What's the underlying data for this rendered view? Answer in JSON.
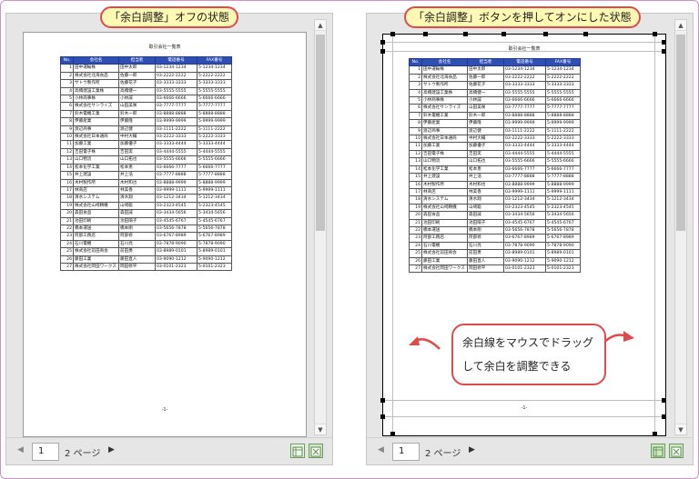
{
  "left_label": "「余白調整」オフの状態",
  "right_label": "「余白調整」ボタンを押してオンにした状態",
  "callout_line1": "余白線をマウスでドラッグ",
  "callout_line2": "して余白を調整できる",
  "sheet_title": "取引会社一覧表",
  "page_number_mark": "-1-",
  "page_input_value": "1",
  "page_total": "2 ページ",
  "columns": [
    "No.",
    "会社名",
    "担当者",
    "電話番号",
    "FAX番号"
  ],
  "rows": [
    [
      "1",
      "田中運輸株",
      "田中太郎",
      "03-1234-1234",
      "5-1234-1234"
    ],
    [
      "2",
      "株式会社北海食品",
      "佐藤一郎",
      "03-2222-2222",
      "5-2222-2222"
    ],
    [
      "3",
      "サトウ製作所",
      "佐藤花子",
      "03-3333-3333",
      "5-3333-3333"
    ],
    [
      "4",
      "高橋建設工業株",
      "高橋健一",
      "03-5555-5555",
      "5-5555-5555"
    ],
    [
      "5",
      "小林商事株",
      "小林誠",
      "03-6666-6666",
      "5-6666-6666"
    ],
    [
      "6",
      "株式会社サンライズ",
      "山田美咲",
      "03-7777-7777",
      "5-7777-7777"
    ],
    [
      "7",
      "鈴木電機工業",
      "鈴木一郎",
      "03-8888-8888",
      "5-8888-8888"
    ],
    [
      "8",
      "伊藤産業",
      "伊藤隆",
      "03-9999-9999",
      "5-9999-9999"
    ],
    [
      "9",
      "渡辺商事",
      "渡辺健",
      "03-1111-2222",
      "5-1111-2222"
    ],
    [
      "10",
      "株式会社日本通商",
      "中村大輔",
      "03-2222-3333",
      "5-2222-3333"
    ],
    [
      "11",
      "加藤工業",
      "加藤優子",
      "03-3333-4444",
      "5-3333-4444"
    ],
    [
      "12",
      "吉田電子株",
      "吉田実",
      "03-4444-5555",
      "5-4444-5555"
    ],
    [
      "13",
      "山口物流",
      "山口拓也",
      "03-5555-6666",
      "5-5555-6666"
    ],
    [
      "14",
      "松本化学工業",
      "松本恵",
      "03-6666-7777",
      "5-6666-7777"
    ],
    [
      "15",
      "井上建設",
      "井上浩",
      "03-7777-8888",
      "5-7777-8888"
    ],
    [
      "16",
      "木村製作所",
      "木村和也",
      "03-8888-9999",
      "5-8888-9999"
    ],
    [
      "17",
      "林商店",
      "林美香",
      "03-9999-1111",
      "5-9999-1111"
    ],
    [
      "18",
      "清水システム",
      "清水翔",
      "03-1212-3434",
      "5-1212-3434"
    ],
    [
      "19",
      "株式会社山崎精機",
      "山崎聡",
      "03-2323-4545",
      "5-2323-4545"
    ],
    [
      "20",
      "森田食品",
      "森田誠",
      "03-3434-5656",
      "5-3434-5656"
    ],
    [
      "21",
      "池田印刷",
      "池田陽子",
      "03-4545-6767",
      "5-4545-6767"
    ],
    [
      "22",
      "橋本運送",
      "橋本剛",
      "03-5656-7878",
      "5-5656-7878"
    ],
    [
      "23",
      "阿部工務店",
      "阿部修",
      "03-6767-8989",
      "5-6767-8989"
    ],
    [
      "24",
      "石川電機",
      "石川亮",
      "03-7878-9090",
      "5-7878-9090"
    ],
    [
      "25",
      "株式会社前田商会",
      "前田勇",
      "03-8989-0101",
      "5-8989-0101"
    ],
    [
      "26",
      "藤田工業",
      "藤田直人",
      "03-9090-1212",
      "5-9090-1212"
    ],
    [
      "27",
      "株式会社岡田ワークス",
      "岡田修平",
      "03-0101-2323",
      "5-0101-2323"
    ]
  ],
  "icons": {
    "prev": "triangle-left-icon",
    "next": "triangle-right-icon",
    "show_margins": "show-margins-icon",
    "zoom_page": "zoom-to-page-icon"
  },
  "colors": {
    "header_blue": "#2f4fb5",
    "bubble_border": "#e04a4a",
    "bubble_fill": "#fff9b3"
  }
}
